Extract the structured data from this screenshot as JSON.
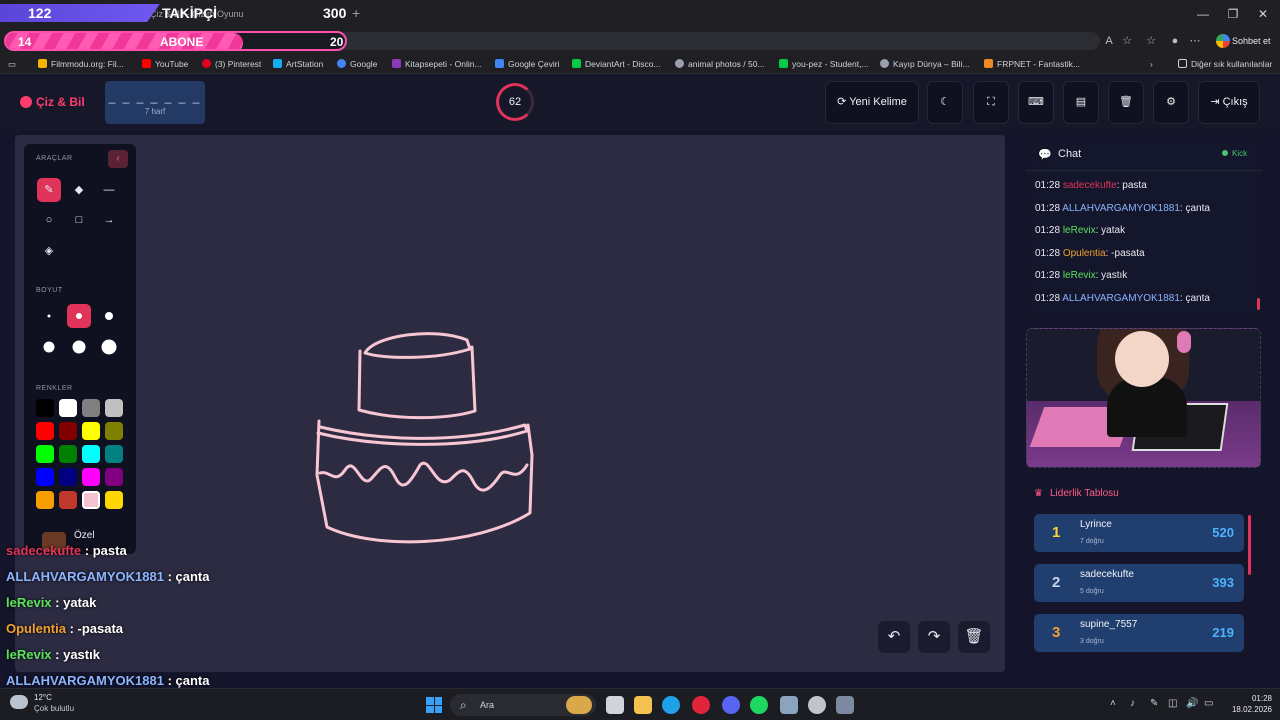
{
  "browser": {
    "tab_title": "Çiz & Bil - Çizim Oyunu",
    "url_hint": "guess",
    "new_tab": "+",
    "chat_button": "Sohbet et",
    "window_controls": [
      "—",
      "❐",
      "✕"
    ],
    "bookmarks": [
      {
        "label": "Filmmodu.org: Fil...",
        "color": "#f5b400"
      },
      {
        "label": "YouTube",
        "color": "#ff0000"
      },
      {
        "label": "(3) Pinterest",
        "color": "#e60023"
      },
      {
        "label": "ArtStation",
        "color": "#13aff0"
      },
      {
        "label": "Google",
        "color": "#4285f4"
      },
      {
        "label": "Kitapsepeti - Onlin...",
        "color": "#8a3ab9"
      },
      {
        "label": "Google Çeviri",
        "color": "#4285f4"
      },
      {
        "label": "DeviantArt - Disco...",
        "color": "#05cc47"
      },
      {
        "label": "animal photos / 50...",
        "color": "#9aa0ab"
      },
      {
        "label": "you-pez - Student,...",
        "color": "#05cc47"
      },
      {
        "label": "Kayıp Dünya – Bili...",
        "color": "#9aa0ab"
      },
      {
        "label": "FRPNET - Fantastik...",
        "color": "#f08a24"
      }
    ],
    "other_bookmarks": "Diğer sık kullanılanlar"
  },
  "overlay": {
    "followers": {
      "count": "122",
      "label": "TAKİPÇİ",
      "goal": "300",
      "progress": 0.41
    },
    "subs": {
      "count": "14",
      "label": "ABONE",
      "goal": "20",
      "progress": 0.7
    },
    "chat": [
      {
        "user": "sadecekufte",
        "text": " : pasta",
        "color": "#e0345a"
      },
      {
        "user": "ALLAHVARGAMYOK1881",
        "text": " : çanta",
        "color": "#8cb4ff"
      },
      {
        "user": "leRevix",
        "text": " : yatak",
        "color": "#5ce25c"
      },
      {
        "user": "Opulentia",
        "text": " : -pasata",
        "color": "#f0a030"
      },
      {
        "user": "leRevix",
        "text": " : yastık",
        "color": "#5ce25c"
      },
      {
        "user": "ALLAHVARGAMYOK1881",
        "text": " : çanta",
        "color": "#8cb4ff"
      }
    ]
  },
  "app": {
    "brand": "Çiz & Bil",
    "word_hint": "_ _ _ _ _ _ _",
    "word_length": "7 harf",
    "timer": "62",
    "buttons": {
      "new_word": "Yeni Kelime",
      "logout": "Çıkış"
    },
    "icons": [
      "moon-icon",
      "fullscreen-icon",
      "keyboard-icon",
      "archive-icon",
      "trash-icon",
      "gear-icon"
    ]
  },
  "tools": {
    "tools_label": "ARAÇLAR",
    "size_label": "BOYUT",
    "colors_label": "RENKLER",
    "custom_label": "Özel",
    "palette": [
      "#000000",
      "#ffffff",
      "#808080",
      "#c0c0c0",
      "#ff0000",
      "#800000",
      "#ffff00",
      "#808000",
      "#00ff00",
      "#008000",
      "#00ffff",
      "#008080",
      "#0000ff",
      "#000080",
      "#ff00ff",
      "#800080",
      "#f5a000",
      "#c0392b",
      "#f4c2d0",
      "#ffd700"
    ],
    "selected_color": "#f4c2d0",
    "selected_size": 2
  },
  "chat": {
    "title": "Chat",
    "status": "Kick",
    "messages": [
      {
        "time": "01:28",
        "user": "sadecekufte",
        "text": ": pasta",
        "color": "#e0345a"
      },
      {
        "time": "01:28",
        "user": "ALLAHVARGAMYOK1881",
        "text": ": çanta",
        "color": "#8cb4ff"
      },
      {
        "time": "01:28",
        "user": "leRevix",
        "text": ": yatak",
        "color": "#5ce25c"
      },
      {
        "time": "01:28",
        "user": "Opulentia",
        "text": ": -pasata",
        "color": "#f0a030"
      },
      {
        "time": "01:28",
        "user": "leRevix",
        "text": ": yastık",
        "color": "#5ce25c"
      },
      {
        "time": "01:28",
        "user": "ALLAHVARGAMYOK1881",
        "text": ": çanta",
        "color": "#8cb4ff"
      }
    ]
  },
  "leaderboard": {
    "title": "Liderlik Tablosu",
    "rows": [
      {
        "rank": "1",
        "name": "Lyrince",
        "correct": "7 doğru",
        "score": "520",
        "rank_color": "#ffd43b"
      },
      {
        "rank": "2",
        "name": "sadecekufte",
        "correct": "5 doğru",
        "score": "393",
        "rank_color": "#c9d3ea"
      },
      {
        "rank": "3",
        "name": "supine_7557",
        "correct": "3 doğru",
        "score": "219",
        "rank_color": "#f0a030"
      }
    ]
  },
  "taskbar": {
    "temp": "12°C",
    "weather": "Çok bulutlu",
    "search": "Ara",
    "time": "01:28",
    "date": "18.02.2026"
  }
}
